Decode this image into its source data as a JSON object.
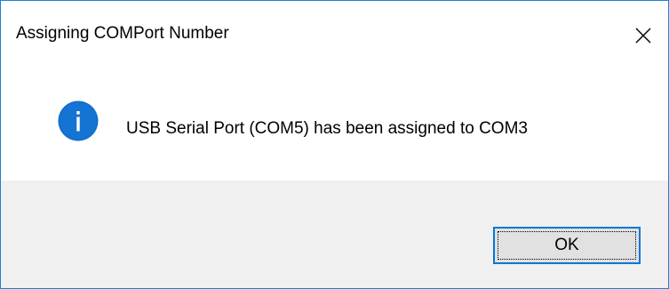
{
  "window": {
    "title": "Assigning COMPort Number",
    "close_icon": "close-icon",
    "border_color": "#1883d7"
  },
  "message": {
    "icon": "info-icon",
    "icon_color": "#0f6fc6",
    "text": "USB Serial Port (COM5) has been assigned to COM3"
  },
  "buttons": {
    "ok_label": "OK",
    "ok_border_color": "#0078d7"
  }
}
